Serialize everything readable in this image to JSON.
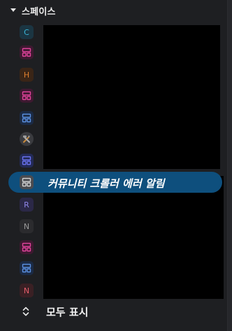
{
  "header": {
    "title": "스페이스"
  },
  "spaces": [
    {
      "icon": "letter-badge",
      "letter": "C",
      "color": "#3ab6d8"
    },
    {
      "icon": "grid-icon",
      "color": "#e0439b"
    },
    {
      "icon": "letter-badge",
      "letter": "H",
      "color": "#e0802e"
    },
    {
      "icon": "grid-icon",
      "color": "#e0439b"
    },
    {
      "icon": "grid-icon",
      "color": "#5a8fe0"
    },
    {
      "icon": "tools-icon",
      "color": "#c8862a"
    },
    {
      "icon": "grid-icon",
      "color": "#6a72f0"
    },
    {
      "icon": "grid-icon",
      "color": "#c9c9c9",
      "active": true,
      "label": "커뮤니티 크롤러 에러 알림"
    },
    {
      "icon": "letter-badge",
      "letter": "R",
      "color": "#8f86e8"
    },
    {
      "icon": "letter-badge",
      "letter": "N",
      "color": "#9a9a9a"
    },
    {
      "icon": "grid-icon",
      "color": "#e0439b"
    },
    {
      "icon": "grid-icon",
      "color": "#5a8fe0"
    },
    {
      "icon": "letter-badge",
      "letter": "N",
      "color": "#e35d6a"
    }
  ],
  "active_space": {
    "label": "커뮤니티 크롤러 에러 알림",
    "highlight_color": "#0e4f7d"
  },
  "footer": {
    "show_all_label": "모두 표시",
    "icon": "chevron-up-down-icon"
  }
}
